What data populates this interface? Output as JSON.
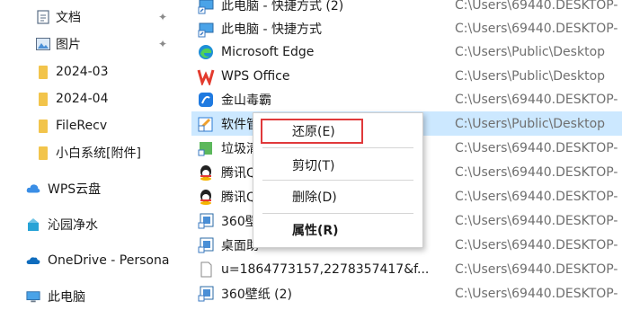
{
  "nav": {
    "items": [
      {
        "label": "文档",
        "icon": "document-icon",
        "pinned": true
      },
      {
        "label": "图片",
        "icon": "pictures-icon",
        "pinned": true
      },
      {
        "label": "2024-03",
        "icon": "folder-icon",
        "pinned": false
      },
      {
        "label": "2024-04",
        "icon": "folder-icon",
        "pinned": false
      },
      {
        "label": "FileRecv",
        "icon": "folder-icon",
        "pinned": false
      },
      {
        "label": "小白系统[附件]",
        "icon": "folder-icon",
        "pinned": false
      },
      {
        "label": "WPS云盘",
        "icon": "wps-cloud-icon",
        "pinned": false
      },
      {
        "label": "沁园净水",
        "icon": "app-icon",
        "pinned": false
      },
      {
        "label": "OneDrive - Persona",
        "icon": "onedrive-icon",
        "pinned": false
      },
      {
        "label": "此电脑",
        "icon": "this-pc-icon",
        "pinned": false
      }
    ]
  },
  "files": [
    {
      "name": "此电脑 - 快捷方式 (2)",
      "path": "C:\\Users\\69440.DESKTOP-"
    },
    {
      "name": "此电脑 - 快捷方式",
      "path": "C:\\Users\\69440.DESKTOP-"
    },
    {
      "name": "Microsoft Edge",
      "path": "C:\\Users\\Public\\Desktop"
    },
    {
      "name": "WPS Office",
      "path": "C:\\Users\\Public\\Desktop"
    },
    {
      "name": "金山毒霸",
      "path": "C:\\Users\\69440.DESKTOP-"
    },
    {
      "name": "软件管",
      "path": "C:\\Users\\Public\\Desktop",
      "selected": true
    },
    {
      "name": "垃圾清",
      "path": "C:\\Users\\69440.DESKTOP-"
    },
    {
      "name": "腾讯Q",
      "path": "C:\\Users\\69440.DESKTOP-"
    },
    {
      "name": "腾讯Q",
      "path": "C:\\Users\\69440.DESKTOP-"
    },
    {
      "name": "360壁",
      "path": "C:\\Users\\69440.DESKTOP-"
    },
    {
      "name": "桌面助",
      "path": "C:\\Users\\69440.DESKTOP-"
    },
    {
      "name": "u=1864773157,2278357417&f...",
      "path": "C:\\Users\\69440.DESKTOP-"
    },
    {
      "name": "360壁纸 (2)",
      "path": "C:\\Users\\69440.DESKTOP-"
    }
  ],
  "context_menu": {
    "restore": "还原(E)",
    "cut": "剪切(T)",
    "delete": "删除(D)",
    "properties": "属性(R)"
  },
  "colors": {
    "selection": "#cce8ff",
    "highlight_box": "#e0393b",
    "folder": "#f2c44b"
  }
}
